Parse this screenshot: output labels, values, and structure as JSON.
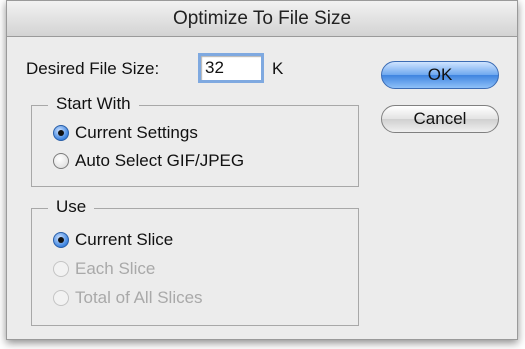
{
  "dialog": {
    "title": "Optimize To File Size",
    "desired_size_label": "Desired File Size:",
    "desired_size_value": "32",
    "desired_size_unit": "K",
    "start_with": {
      "title": "Start With",
      "options": [
        {
          "label": "Current Settings",
          "selected": true,
          "enabled": true
        },
        {
          "label": "Auto Select GIF/JPEG",
          "selected": false,
          "enabled": true
        }
      ]
    },
    "use": {
      "title": "Use",
      "options": [
        {
          "label": "Current Slice",
          "selected": true,
          "enabled": true
        },
        {
          "label": "Each Slice",
          "selected": false,
          "enabled": false
        },
        {
          "label": "Total of All Slices",
          "selected": false,
          "enabled": false
        }
      ]
    },
    "buttons": {
      "ok_label": "OK",
      "cancel_label": "Cancel"
    }
  }
}
